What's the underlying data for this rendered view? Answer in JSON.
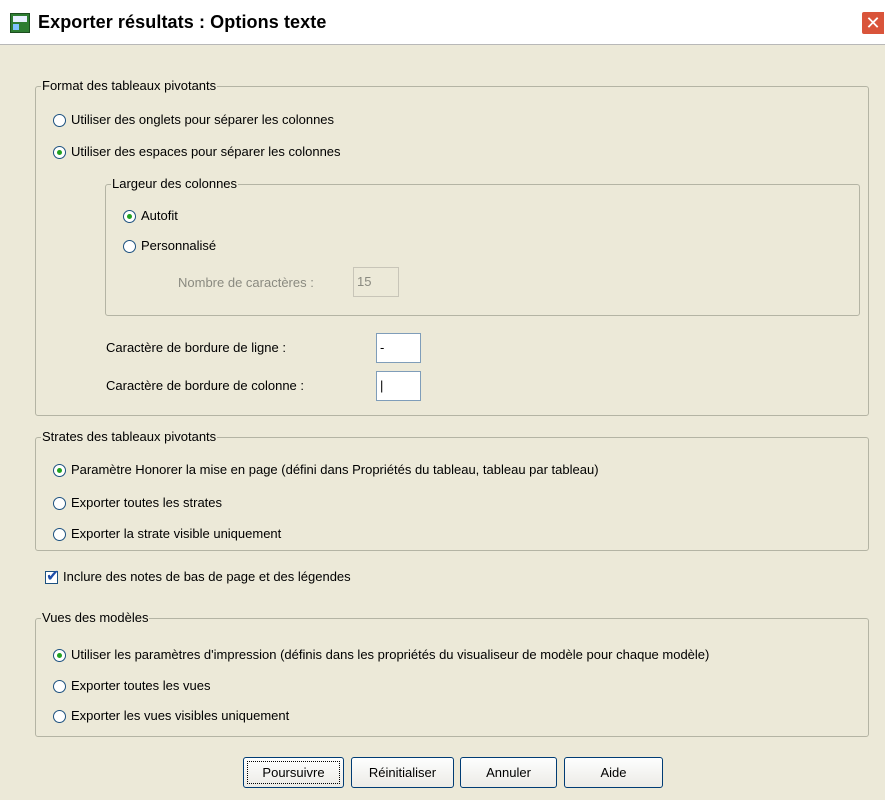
{
  "window": {
    "title": "Exporter résultats : Options texte",
    "close_glyph": "✕"
  },
  "format_group": {
    "title": "Format des tableaux pivotants",
    "options": [
      {
        "label": "Utiliser des onglets pour séparer les colonnes",
        "selected": false
      },
      {
        "label": "Utiliser des espaces pour séparer les colonnes",
        "selected": true
      }
    ],
    "column_width": {
      "title": "Largeur des colonnes",
      "options": [
        {
          "label": "Autofit",
          "selected": true
        },
        {
          "label": "Personnalisé",
          "selected": false
        }
      ],
      "char_count_label": "Nombre de caractères :",
      "char_count_value": "15"
    },
    "row_border_label": "Caractère de bordure de ligne :",
    "row_border_value": "-",
    "column_border_label": "Caractère de bordure de colonne :",
    "column_border_value": "|"
  },
  "layers_group": {
    "title": "Strates des tableaux pivotants",
    "options": [
      {
        "label": "Paramètre Honorer la mise en page (défini dans Propriétés du tableau, tableau par tableau)",
        "selected": true
      },
      {
        "label": "Exporter toutes les strates",
        "selected": false
      },
      {
        "label": "Exporter la strate visible uniquement",
        "selected": false
      }
    ]
  },
  "footnotes": {
    "label": "Inclure des notes de bas de page et des légendes",
    "checked": true
  },
  "models_group": {
    "title": "Vues des modèles",
    "options": [
      {
        "label": "Utiliser les paramètres d'impression (définis dans les propriétés du visualiseur de modèle pour chaque modèle)",
        "selected": true
      },
      {
        "label": "Exporter toutes les vues",
        "selected": false
      },
      {
        "label": "Exporter les vues visibles uniquement",
        "selected": false
      }
    ]
  },
  "buttons": {
    "continue": "Poursuivre",
    "reset": "Réinitialiser",
    "cancel": "Annuler",
    "help": "Aide"
  }
}
